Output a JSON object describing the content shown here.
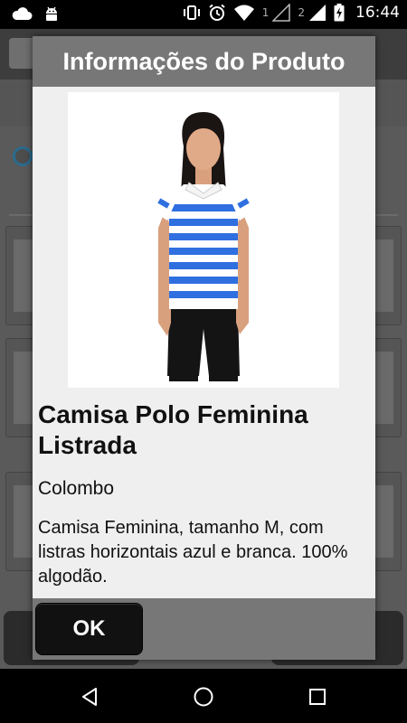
{
  "status_bar": {
    "time": "16:44",
    "sim1": "1",
    "sim2": "2"
  },
  "dialog": {
    "title": "Informações do Produto",
    "product": {
      "name": "Camisa Polo Feminina Listrada",
      "brand": "Colombo",
      "description": "Camisa Feminina, tamanho M, com listras horizontais azul e branca. 100% algodão."
    },
    "ok_label": "OK"
  },
  "colors": {
    "dialog_header": "#777777",
    "dialog_body": "#efefef",
    "ok_button": "#111111",
    "shirt_stripe": "#2f6fe0"
  },
  "icons": [
    "cloud-icon",
    "android-icon",
    "vibrate-icon",
    "alarm-icon",
    "wifi-icon",
    "signal-icon",
    "battery-icon",
    "back-icon",
    "home-icon",
    "recents-icon"
  ]
}
